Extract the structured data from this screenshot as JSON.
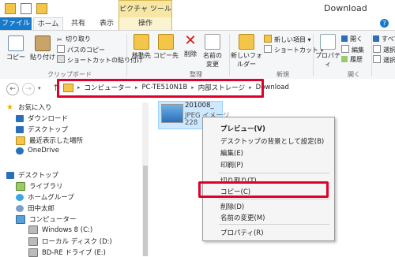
{
  "window": {
    "title": "Download",
    "contextual_group": "ピクチャ ツール"
  },
  "tabs": [
    "ファイル",
    "ホーム",
    "共有",
    "表示",
    "操作"
  ],
  "ribbon": {
    "clipboard": {
      "copy": "コピー",
      "paste": "貼り付け",
      "cut": "切り取り",
      "copy_path": "パスのコピー",
      "paste_shortcut": "ショートカットの貼り付け",
      "label": "クリップボード"
    },
    "organize": {
      "move_to": "移動先",
      "copy_to": "コピー先",
      "delete": "削除",
      "rename": "名前の変更",
      "label": "整理"
    },
    "new": {
      "new_folder": "新しいフォルダー",
      "new_item": "新しい項目",
      "shortcut": "ショートカット",
      "label": "新規"
    },
    "open": {
      "properties": "プロパティ",
      "open": "開く",
      "edit": "編集",
      "history": "履歴",
      "label": "開く"
    },
    "select": {
      "item1": "すべて",
      "item2": "選択",
      "item3": "選択"
    }
  },
  "address": {
    "crumbs": [
      "コンピューター",
      "PC-TE510N1B",
      "内部ストレージ",
      "Download"
    ]
  },
  "nav": {
    "favorites": "お気に入り",
    "items": [
      {
        "label": "ダウンロード",
        "icon": "download-folder-icon"
      },
      {
        "label": "デスクトップ",
        "icon": "desktop-icon"
      },
      {
        "label": "最近表示した場所",
        "icon": "recent-places-icon"
      },
      {
        "label": "OneDrive",
        "icon": "onedrive-icon"
      }
    ],
    "desktop": "デスクトップ",
    "tree": [
      {
        "label": "ライブラリ",
        "icon": "library-icon"
      },
      {
        "label": "ホームグループ",
        "icon": "homegroup-icon"
      },
      {
        "label": "田中太郎",
        "icon": "user-icon"
      },
      {
        "label": "コンピューター",
        "icon": "computer-icon"
      },
      {
        "label": "Windows 8 (C:)",
        "icon": "drive-icon"
      },
      {
        "label": "ローカル ディスク (D:)",
        "icon": "drive-icon"
      },
      {
        "label": "BD-RE ドライブ (E:)",
        "icon": "drive-icon"
      }
    ]
  },
  "file": {
    "name": "201008_",
    "type": "JPEG イメージ",
    "size": "228"
  },
  "context_menu": {
    "items": [
      "プレビュー(V)",
      "デスクトップの背景として設定(B)",
      "編集(E)",
      "印刷(P)",
      "切り取り(T)",
      "コピー(C)",
      "削除(D)",
      "名前の変更(M)",
      "プロパティ(R)"
    ]
  },
  "colors": {
    "accent": "#1979ca",
    "highlight": "#e0002a",
    "selection": "#cde8ff"
  }
}
